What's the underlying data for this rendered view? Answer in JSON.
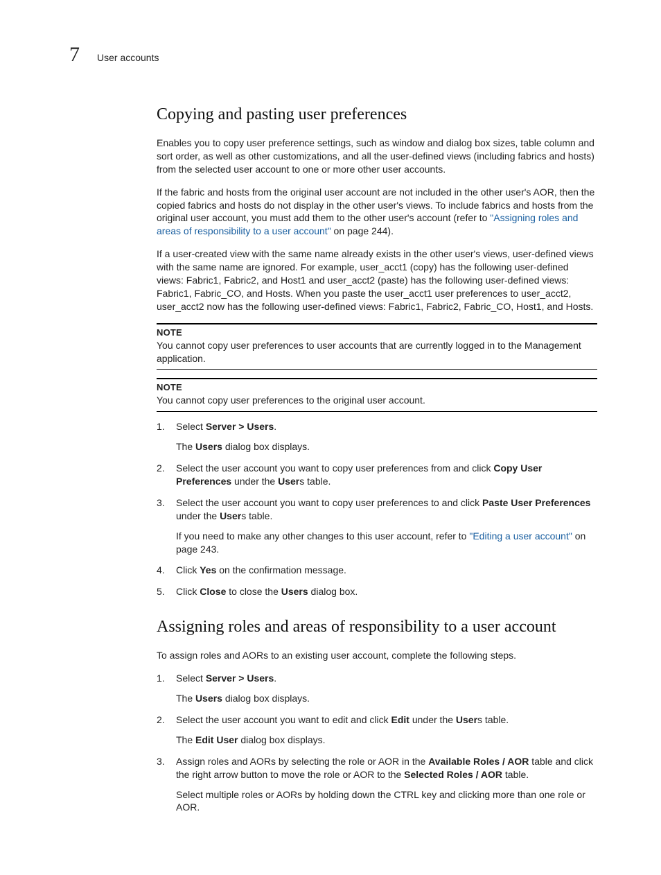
{
  "chapter_number": "7",
  "section_header": "User accounts",
  "h2_a": "Copying and pasting user preferences",
  "pA1": "Enables you to copy user preference settings, such as window and dialog box sizes, table column and sort order, as well as other customizations, and all the user-defined views (including fabrics and hosts) from the selected user account to one or more other user accounts.",
  "pA2_pre": "If the fabric and hosts from the original user account are not included in the other user's AOR, then the copied fabrics and hosts do not display in the other user's views. To include fabrics and hosts from the original user account, you must add them to the other user's account (refer to ",
  "pA2_link": "\"Assigning roles and areas of responsibility to a user account\"",
  "pA2_post": " on page 244).",
  "pA3": "If a user-created view with the same name already exists in the other user's views, user-defined views with the same name are ignored. For example, user_acct1 (copy) has the following user-defined views: Fabric1, Fabric2, and Host1 and user_acct2 (paste) has the following user-defined views: Fabric1, Fabric_CO, and Hosts. When you paste the user_acct1 user preferences to user_acct2, user_acct2 now has the following user-defined views: Fabric1, Fabric2, Fabric_CO, Host1, and Hosts.",
  "note_label": "NOTE",
  "note1": "You cannot copy user preferences to user accounts that are currently logged in to the Management application.",
  "note2": "You cannot copy user preferences to the original user account.",
  "stepsA": {
    "s1_a": "Select ",
    "s1_b": "Server > Users",
    "s1_c": ".",
    "s1_sub_a": "The ",
    "s1_sub_b": "Users",
    "s1_sub_c": " dialog box displays.",
    "s2_a": "Select the user account you want to copy user preferences from and click ",
    "s2_b": "Copy User Preferences",
    "s2_c": " under the ",
    "s2_d": "User",
    "s2_e": "s table.",
    "s3_a": "Select the user account you want to copy user preferences to and click ",
    "s3_b": "Paste User Preferences",
    "s3_c": " under the ",
    "s3_d": "User",
    "s3_e": "s table.",
    "s3_sub_a": "If you need to make any other changes to this user account, refer to ",
    "s3_sub_link": "\"Editing a user account\"",
    "s3_sub_b": " on page 243.",
    "s4_a": "Click ",
    "s4_b": "Yes",
    "s4_c": " on the confirmation message.",
    "s5_a": "Click ",
    "s5_b": "Close",
    "s5_c": " to close the ",
    "s5_d": "Users",
    "s5_e": " dialog box."
  },
  "h2_b": "Assigning roles and areas of responsibility to a user account",
  "pB1": "To assign roles and AORs to an existing user account, complete the following steps.",
  "stepsB": {
    "s1_a": "Select ",
    "s1_b": "Server > Users",
    "s1_c": ".",
    "s1_sub_a": "The ",
    "s1_sub_b": "Users",
    "s1_sub_c": " dialog box displays.",
    "s2_a": "Select the user account you want to edit and click ",
    "s2_b": "Edit",
    "s2_c": " under the ",
    "s2_d": "User",
    "s2_e": "s table.",
    "s2_sub_a": "The ",
    "s2_sub_b": "Edit User",
    "s2_sub_c": " dialog box displays.",
    "s3_a": "Assign roles and AORs by selecting the role or AOR in the ",
    "s3_b": "Available Roles / AOR",
    "s3_c": " table and click the right arrow button to move the role or AOR to the ",
    "s3_d": "Selected Roles / AOR",
    "s3_e": " table.",
    "s3_sub": "Select multiple roles or AORs by holding down the CTRL key and clicking more than one role or AOR."
  }
}
